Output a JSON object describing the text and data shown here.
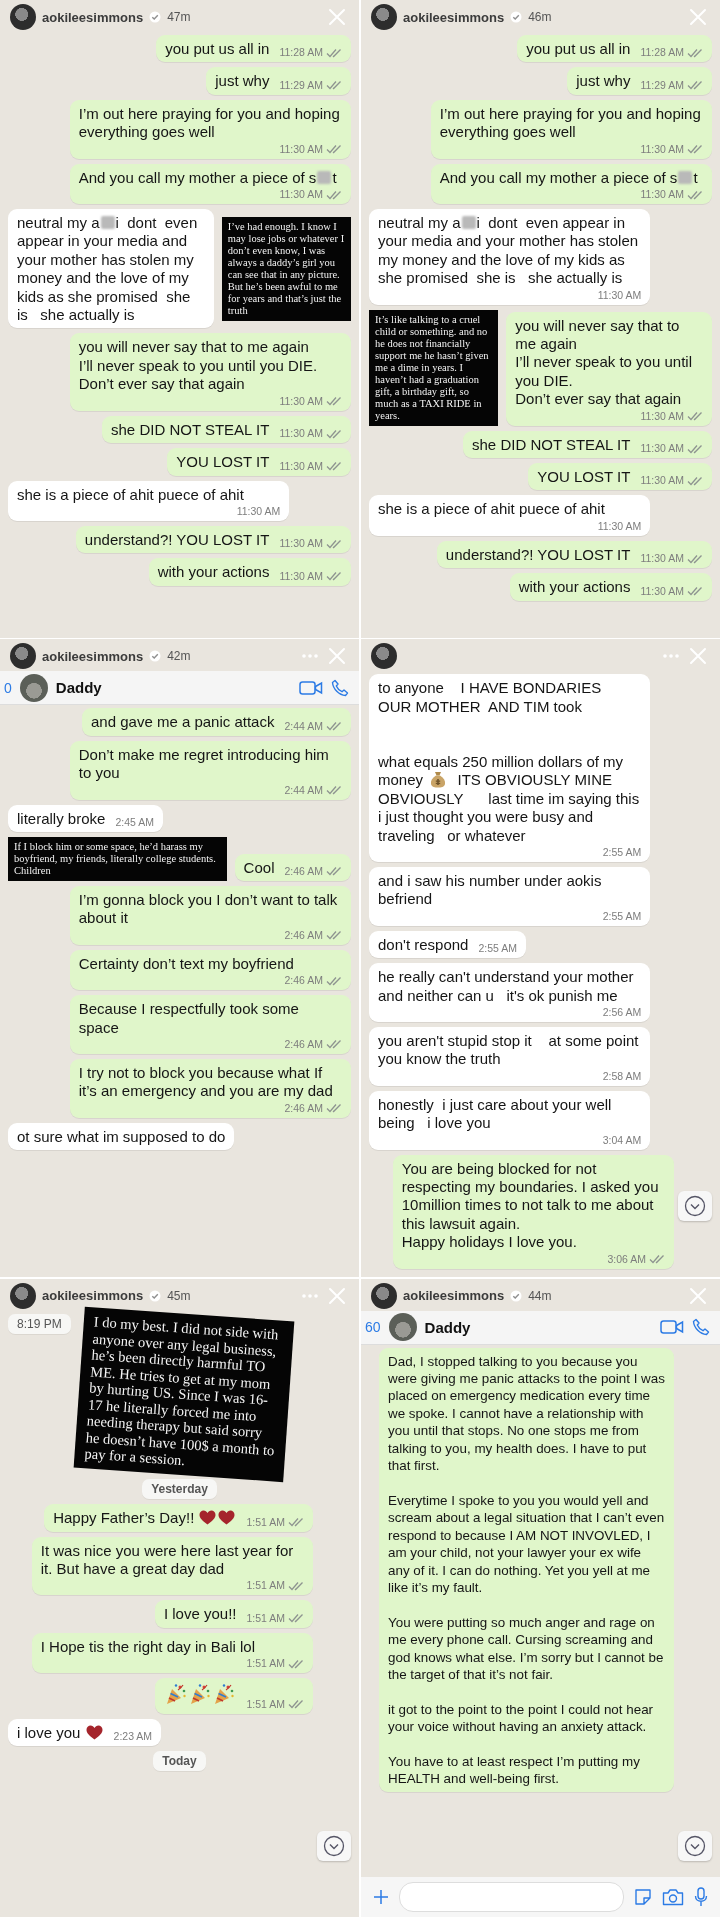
{
  "panels": [
    {
      "story": {
        "username": "aokileesimmons",
        "age": "47m"
      },
      "messages": [
        {
          "kind": "sent",
          "text": "you put us all in",
          "time": "11:28 AM"
        },
        {
          "kind": "sent",
          "text": "just why",
          "time": "11:29 AM"
        },
        {
          "kind": "sent",
          "text": "I’m out here praying for you and hoping everything goes well",
          "time": "11:30 AM"
        },
        {
          "kind": "sent",
          "parts": [
            {
              "kind": "text",
              "text": "And you call my mother a piece of s"
            },
            {
              "kind": "blur"
            },
            {
              "kind": "text",
              "text": "t"
            }
          ],
          "time": "11:30 AM"
        },
        {
          "kind": "row",
          "items": [
            {
              "kind": "received",
              "parts": [
                {
                  "kind": "text",
                  "text": "neutral my a"
                },
                {
                  "kind": "blur"
                },
                {
                  "kind": "text",
                  "text": "i  dont  even appear in your media and your mother has stolen my money and the love of my kids as she promised  she is   she actually is"
                }
              ]
            },
            {
              "kind": "caption",
              "text": "I’ve had enough. I know I may lose jobs or whatever I don’t even know, I was always a daddy’s girl you can see that in any picture. But he’s been awful to me for years and that’s just the truth"
            }
          ]
        },
        {
          "kind": "sent",
          "text": "you will never say that to me again\nI’ll never speak to you until you DIE.\nDon’t ever say that again",
          "time": "11:30 AM"
        },
        {
          "kind": "sent",
          "text": "she DID NOT STEAL IT",
          "time": "11:30 AM"
        },
        {
          "kind": "sent",
          "text": "YOU LOST IT",
          "time": "11:30 AM"
        },
        {
          "kind": "received",
          "text": "she is a piece of ahit puece of ahit",
          "time": "11:30 AM"
        },
        {
          "kind": "sent",
          "text": "understand?! YOU LOST IT",
          "time": "11:30 AM"
        },
        {
          "kind": "sent",
          "text": "with your actions",
          "time": "11:30 AM"
        }
      ]
    },
    {
      "story": {
        "username": "aokileesimmons",
        "age": "46m"
      },
      "messages": [
        {
          "kind": "sent",
          "text": "you put us all in",
          "time": "11:28 AM"
        },
        {
          "kind": "sent",
          "text": "just why",
          "time": "11:29 AM"
        },
        {
          "kind": "sent",
          "text": "I’m out here praying for you and hoping everything goes well",
          "time": "11:30 AM"
        },
        {
          "kind": "sent",
          "parts": [
            {
              "kind": "text",
              "text": "And you call my mother a piece of s"
            },
            {
              "kind": "blur"
            },
            {
              "kind": "text",
              "text": "t"
            }
          ],
          "time": "11:30 AM"
        },
        {
          "kind": "received",
          "parts": [
            {
              "kind": "text",
              "text": "neutral my a"
            },
            {
              "kind": "blur"
            },
            {
              "kind": "text",
              "text": "i  dont  even appear in your media and your mother has stolen my money and the love of my kids as she promised  she is   she actually is"
            }
          ],
          "time": "11:30 AM"
        },
        {
          "kind": "row",
          "items": [
            {
              "kind": "caption",
              "text": "It’s like talking to a cruel child or something. and no he does not financially support me he hasn’t given me a dime in years. I haven’t had a graduation gift, a birthday gift, so much as a TAXI RIDE in years."
            },
            {
              "kind": "sent",
              "text": "you will never say that to me again\nI’ll never speak to you until you DIE.\nDon’t ever say that again",
              "time": "11:30 AM"
            }
          ]
        },
        {
          "kind": "sent",
          "text": "she DID NOT STEAL IT",
          "time": "11:30 AM"
        },
        {
          "kind": "sent",
          "text": "YOU LOST IT",
          "time": "11:30 AM"
        },
        {
          "kind": "received",
          "text": "she is a piece of ahit puece of ahit",
          "time": "11:30 AM"
        },
        {
          "kind": "sent",
          "text": "understand?! YOU LOST IT",
          "time": "11:30 AM"
        },
        {
          "kind": "sent",
          "text": "with your actions",
          "time": "11:30 AM"
        }
      ]
    },
    {
      "story": {
        "username": "aokileesimmons",
        "age": "42m"
      },
      "more_menu": true,
      "chat_header": {
        "back_count": "0",
        "title": "Daddy"
      },
      "messages": [
        {
          "kind": "sent",
          "text": "and gave me a panic attack",
          "time": "2:44 AM"
        },
        {
          "kind": "sent",
          "text": "Don’t make me regret introducing him to you",
          "time": "2:44 AM"
        },
        {
          "kind": "received",
          "text": "literally broke",
          "time": "2:45 AM"
        },
        {
          "kind": "row",
          "items": [
            {
              "kind": "caption",
              "text": "If I block him or some space, he’d harass my boyfriend, my friends, literally college students. Children"
            },
            {
              "kind": "sent",
              "text": "Cool",
              "time": "2:46 AM"
            }
          ]
        },
        {
          "kind": "sent",
          "text": "I’m gonna block you I don’t want to talk about it",
          "time": "2:46 AM"
        },
        {
          "kind": "sent",
          "text": "Certainty don’t text my boyfriend",
          "time": "2:46 AM"
        },
        {
          "kind": "sent",
          "text": "Because I respectfully took some space",
          "time": "2:46 AM"
        },
        {
          "kind": "sent",
          "text": "I try not to block you because what If it’s an emergency and you are my dad",
          "time": "2:46 AM"
        },
        {
          "kind": "received",
          "text": "ot sure what im supposed to do"
        }
      ]
    },
    {
      "more_menu": true,
      "scroll_down_button": true,
      "messages": [
        {
          "kind": "received",
          "parts": [
            {
              "kind": "text",
              "text": "to anyone    I HAVE BONDARIES\nOUR MOTHER  AND TIM took\n\n\nwhat equals 250 million dollars of my money "
            },
            {
              "kind": "money"
            },
            {
              "kind": "text",
              "text": "  ITS OBVIOUSLY MINE   OBVIOUSLY      last time im saying this    i just thought you were busy and traveling   or whatever"
            }
          ],
          "time": "2:55 AM"
        },
        {
          "kind": "received",
          "text": "and i saw his number under aokis befriend",
          "time": "2:55 AM"
        },
        {
          "kind": "received",
          "text": "don't respond",
          "time": "2:55 AM"
        },
        {
          "kind": "received",
          "text": "he really can't understand your mother\nand neither can u   it's ok punish me",
          "time": "2:56 AM"
        },
        {
          "kind": "received",
          "text": "you aren't stupid stop it    at some point you know the truth",
          "time": "2:58 AM"
        },
        {
          "kind": "received",
          "text": "honestly  i just care about your well being   i love you",
          "time": "3:04 AM"
        },
        {
          "kind": "sent",
          "text": "You are being blocked for not respecting my boundaries. I asked you 10million times to not talk to me about this lawsuit again.\nHappy holidays I love you.",
          "time": "3:06 AM"
        }
      ]
    },
    {
      "story": {
        "username": "aokileesimmons",
        "age": "45m"
      },
      "more_menu": true,
      "scroll_down_button": true,
      "messages": [
        {
          "kind": "row",
          "items": [
            {
              "kind": "stamp",
              "text": "8:19 PM"
            },
            {
              "kind": "caption",
              "text": "I do my best. I did not side with anyone over any legal business, he’s been directly harmful TO ME. He tries to get at my mom by hurting US. Since I was 16-17 he literally forced me into needing therapy but said sorry he doesn’t have 100$ a month to pay for a session."
            }
          ]
        },
        {
          "kind": "date",
          "text": "Yesterday"
        },
        {
          "kind": "sent",
          "parts": [
            {
              "kind": "text",
              "text": "Happy Father’s Day!! "
            },
            {
              "kind": "heart"
            },
            {
              "kind": "heart"
            }
          ],
          "time": "1:51 AM"
        },
        {
          "kind": "sent",
          "text": "It was nice you were here last year for it. But have a great day dad",
          "time": "1:51 AM"
        },
        {
          "kind": "sent",
          "text": "I love you!!",
          "time": "1:51 AM"
        },
        {
          "kind": "sent",
          "text": "I Hope tis the right day in Bali lol",
          "time": "1:51 AM"
        },
        {
          "kind": "sent",
          "parts": [
            {
              "kind": "popper"
            },
            {
              "kind": "popper"
            },
            {
              "kind": "popper"
            }
          ],
          "time": "1:51 AM"
        },
        {
          "kind": "received",
          "parts": [
            {
              "kind": "text",
              "text": "i love you "
            },
            {
              "kind": "heart"
            }
          ],
          "time": "2:23 AM"
        },
        {
          "kind": "date",
          "text": "Today"
        }
      ]
    },
    {
      "story": {
        "username": "aokileesimmons",
        "age": "44m"
      },
      "scroll_down_button": true,
      "composer": true,
      "chat_header": {
        "back_count": "60",
        "title": "Daddy"
      },
      "messages": [
        {
          "kind": "sent",
          "text": "Dad, I stopped talking to you because you were giving me panic attacks to the point I was placed on emergency medication every time we spoke. I cannot have a relationship with you until that stops. No one stops me from talking to you, my health does. I have to put that first.\n\nEverytime I spoke to you you would yell and scream about a legal situation that I can’t even respond to because I AM NOT INVOVLED, I am your child, not your lawyer your ex wife any of it. I can do nothing. Yet you yell at me like it’s my fault.\n\nYou were putting so much anger and rage on me every phone call. Cursing screaming and god knows what else. I’m sorry but I cannot be the target of that it’s not fair.\n\nit got to the point to the point I could not hear your voice without having an anxiety attack.\n\nYou have to at least respect I’m putting my HEALTH and well-being first."
        }
      ]
    }
  ]
}
